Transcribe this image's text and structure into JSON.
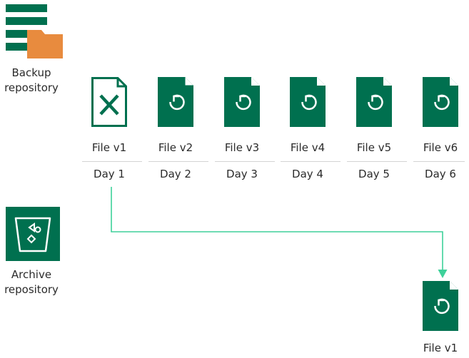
{
  "backup_repository": {
    "label_line1": "Backup",
    "label_line2": "repository",
    "icon": "backup-repository-icon"
  },
  "archive_repository": {
    "label_line1": "Archive",
    "label_line2": "repository",
    "icon": "archive-repository-icon"
  },
  "files": [
    {
      "label": "File v1",
      "day": "Day 1",
      "icon": "excel-file-icon"
    },
    {
      "label": "File v2",
      "day": "Day 2",
      "icon": "restore-file-icon"
    },
    {
      "label": "File v3",
      "day": "Day 3",
      "icon": "restore-file-icon"
    },
    {
      "label": "File v4",
      "day": "Day 4",
      "icon": "restore-file-icon"
    },
    {
      "label": "File v5",
      "day": "Day 5",
      "icon": "restore-file-icon"
    },
    {
      "label": "File v6",
      "day": "Day 6",
      "icon": "restore-file-icon"
    }
  ],
  "archived_file": {
    "label": "File v1",
    "icon": "restore-file-icon"
  },
  "colors": {
    "veeam_green": "#00704f",
    "folder_orange": "#e88b3e",
    "arrow_green": "#3ed19a",
    "divider_gray": "#d4d4d4"
  }
}
